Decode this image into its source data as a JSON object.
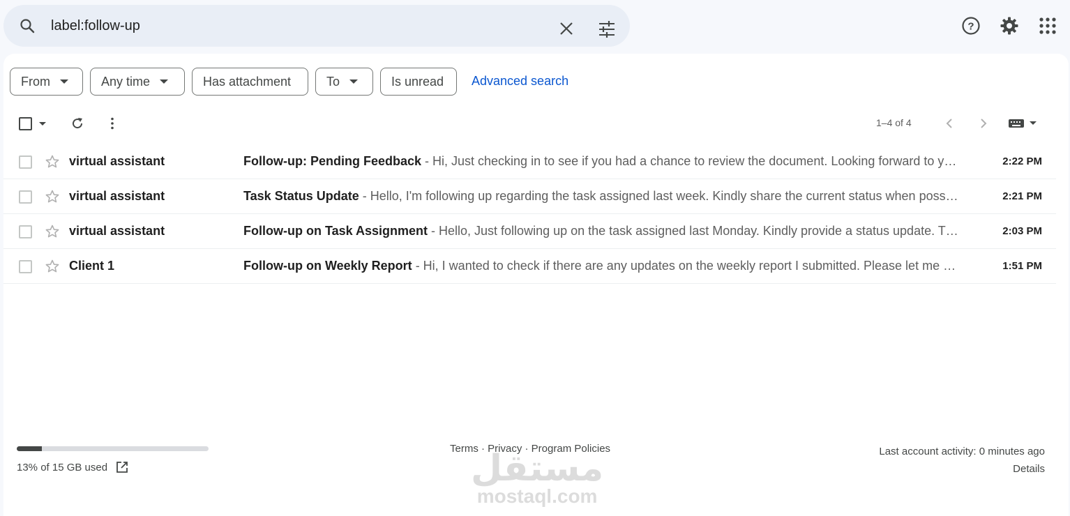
{
  "search": {
    "value": "label:follow-up"
  },
  "filters": {
    "chips": [
      {
        "label": "From",
        "dropdown": true
      },
      {
        "label": "Any time",
        "dropdown": true
      },
      {
        "label": "Has attachment",
        "dropdown": false
      },
      {
        "label": "To",
        "dropdown": true
      },
      {
        "label": "Is unread",
        "dropdown": false
      }
    ],
    "advanced_search": "Advanced search"
  },
  "toolbar": {
    "pager_text": "1–4 of 4"
  },
  "emails": [
    {
      "sender": "virtual assistant",
      "subject": "Follow-up: Pending Feedback",
      "snippet": " - Hi, Just checking in to see if you had a chance to review the document. Looking forward to your feedback.",
      "time": "2:22 PM"
    },
    {
      "sender": "virtual assistant",
      "subject": "Task Status Update",
      "snippet": " - Hello, I'm following up regarding the task assigned last week. Kindly share the current status when possible.",
      "time": "2:21 PM"
    },
    {
      "sender": "virtual assistant",
      "subject": "Follow-up on Task Assignment",
      "snippet": " - Hello, Just following up on the task assigned last Monday. Kindly provide a status update. Thank you.",
      "time": "2:03 PM"
    },
    {
      "sender": "Client 1",
      "subject": "Follow-up on Weekly Report",
      "snippet": " - Hi, I wanted to check if there are any updates on the weekly report I submitted. Please let me know.",
      "time": "1:51 PM"
    }
  ],
  "footer": {
    "storage_text": "13% of 15 GB used",
    "storage_fraction": 0.13,
    "links": "Terms · Privacy · Program Policies",
    "last_activity": "Last account activity: 0 minutes ago",
    "details": "Details"
  },
  "watermark": {
    "arabic": "مستقل",
    "latin": "mostaql.com"
  },
  "colors": {
    "accent": "#0b57d0",
    "page_bg": "#f6f8fc",
    "search_bg": "#e9eef6"
  }
}
